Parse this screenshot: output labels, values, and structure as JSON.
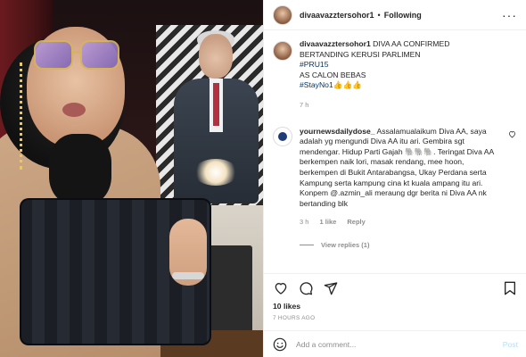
{
  "post": {
    "username": "divaavazztersohor1",
    "separator": "•",
    "follow_label": "Following",
    "more_label": "···"
  },
  "caption": {
    "username": "divaavazztersohor1",
    "line1": "DIVA AA CONFIRMED",
    "line2": "BERTANDING KERUSI PARLIMEN",
    "hashtag1": "#PRU15",
    "line3": "AS CALON BEBAS",
    "hashtag2": "#StayNo1",
    "emoji": "👍👍👍",
    "time": "7 h"
  },
  "comment": {
    "username": "yournewsdailydose_",
    "text": "Assalamualaikum Diva AA, saya adalah yg mengundi Diva AA itu ari. Gembira sgt mendengar. Hidup Parti Gajah 🐘🐘🐘. Teringat Diva AA berkempen naik lori, masak rendang, mee hoon, berkempen di Bukit Antarabangsa, Ukay Perdana serta Kampung serta kampung cina kt kuala ampang itu ari. Konpem @.azmin_ali meraung dgr berita ni Diva AA nk bertanding blk",
    "time": "3 h",
    "likes": "1 like",
    "reply_label": "Reply",
    "view_replies": "View replies (1)"
  },
  "actions": {
    "likes_count": "10 likes",
    "posted_ago": "7 HOURS AGO"
  },
  "composer": {
    "placeholder": "Add a comment...",
    "post_label": "Post"
  },
  "colors": {
    "link": "#00376b",
    "muted": "#8e8e8e",
    "post_disabled": "#b2dffc"
  }
}
